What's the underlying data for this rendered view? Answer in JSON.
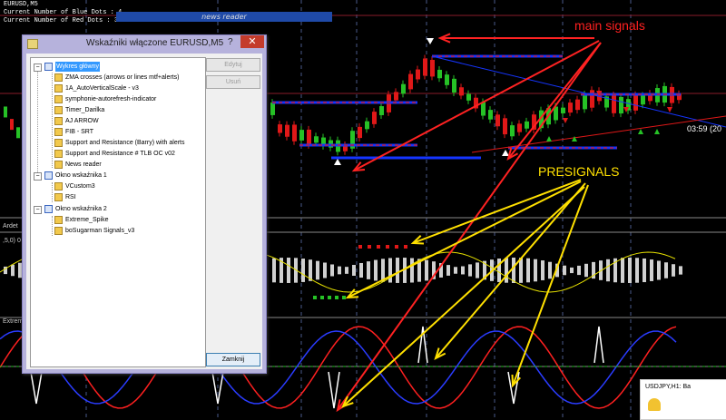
{
  "chart": {
    "symbol": "EURUSD,M5",
    "blue_dots_label": "Current Number of Blue Dots :",
    "blue_dots_value": "4",
    "red_dots_label": "Current Number of Red Dots :",
    "red_dots_value": "3",
    "news_bar": "news reader",
    "time_label": "03:59 (20",
    "subwindow1_label": "Ardet",
    "subwindow2_label": ",5,0) 0",
    "subwindow3_label": "Extrem",
    "colors": {
      "bull": "#26c226",
      "bear": "#e01818",
      "signal_blue": "#1535ff",
      "presignal_yellow": "#ffe000",
      "arrow_red": "#ff2222"
    }
  },
  "annotations": {
    "main_signals": "main signals",
    "presignals": "PRESIGNALS"
  },
  "dialog": {
    "title": "Wskaźniki włączone EURUSD,M5",
    "help": "?",
    "close": "✕",
    "tree": [
      {
        "label": "Wykres główny",
        "type": "window",
        "expanded": true,
        "selected": true
      },
      {
        "label": "ZMA crosses (arrows or lines mtf+alerts)",
        "type": "indicator"
      },
      {
        "label": "1A_AutoVerticalScale - v3",
        "type": "indicator"
      },
      {
        "label": "symphonie-autorefresh-indicator",
        "type": "indicator"
      },
      {
        "label": "Timer_Darilka",
        "type": "indicator"
      },
      {
        "label": "AJ ARROW",
        "type": "indicator"
      },
      {
        "label": "FIB - SRT",
        "type": "indicator"
      },
      {
        "label": "Support and Resistance (Barry) with alerts",
        "type": "indicator"
      },
      {
        "label": "Support and Resistance # TLB OC v02",
        "type": "indicator"
      },
      {
        "label": "News reader",
        "type": "indicator"
      },
      {
        "label": "Okno wskaźnika 1",
        "type": "window",
        "expanded": true
      },
      {
        "label": "VCustom3",
        "type": "indicator"
      },
      {
        "label": "RSI",
        "type": "indicator"
      },
      {
        "label": "Okno wskaźnika 2",
        "type": "window",
        "expanded": true
      },
      {
        "label": "Extreme_Spike",
        "type": "indicator"
      },
      {
        "label": "boSugarman Signals_v3",
        "type": "indicator"
      }
    ],
    "buttons": {
      "edit": "Edytuj",
      "delete": "Usuń",
      "close": "Zamknij"
    }
  },
  "notification": {
    "text": "USDJPY,H1: Ba"
  }
}
